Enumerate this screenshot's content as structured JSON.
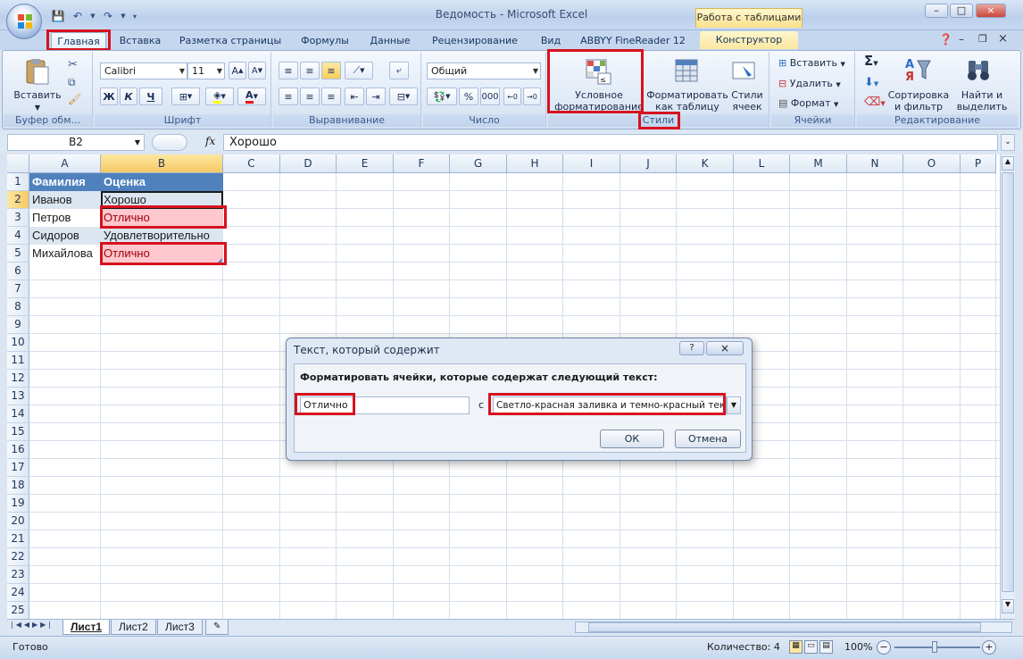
{
  "title_bar": {
    "title": "Ведомость - Microsoft Excel",
    "context_tab_group": "Работа с таблицами",
    "window_buttons": [
      "–",
      "□",
      "×"
    ]
  },
  "ribbon_tabs": [
    "Главная",
    "Вставка",
    "Разметка страницы",
    "Формулы",
    "Данные",
    "Рецензирование",
    "Вид",
    "ABBYY FineReader 12",
    "Конструктор"
  ],
  "ribbon": {
    "clipboard": {
      "label": "Буфер обм...",
      "paste": "Вставить"
    },
    "font": {
      "label": "Шрифт",
      "name": "Calibri",
      "size": "11",
      "bold": "Ж",
      "italic": "К",
      "underline": "Ч"
    },
    "alignment": {
      "label": "Выравнивание"
    },
    "number": {
      "label": "Число",
      "format": "Общий",
      "percent": "%",
      "thousands": "000"
    },
    "styles": {
      "label": "Стили",
      "conditional": "Условное форматирование",
      "as_table": "Форматировать как таблицу",
      "cell_styles": "Стили ячеек"
    },
    "cells": {
      "label": "Ячейки",
      "insert": "Вставить",
      "delete": "Удалить",
      "format": "Формат"
    },
    "editing": {
      "label": "Редактирование",
      "sum": "Σ",
      "sort": "Сортировка и фильтр",
      "find": "Найти и выделить"
    }
  },
  "formula_bar": {
    "name_box": "B2",
    "fx": "fx",
    "value": "Хорошо"
  },
  "columns": [
    "A",
    "B",
    "C",
    "D",
    "E",
    "F",
    "G",
    "H",
    "I",
    "J",
    "K",
    "L",
    "M",
    "N",
    "O",
    "P"
  ],
  "rows": [
    "1",
    "2",
    "3",
    "4",
    "5",
    "6",
    "7",
    "8",
    "9",
    "10",
    "11",
    "12",
    "13",
    "14",
    "15",
    "16",
    "17",
    "18",
    "19",
    "20",
    "21",
    "22",
    "23",
    "24",
    "25"
  ],
  "table": {
    "headers": [
      "Фамилия",
      "Оценка"
    ],
    "rows": [
      [
        "Иванов",
        "Хорошо"
      ],
      [
        "Петров",
        "Отлично"
      ],
      [
        "Сидоров",
        "Удовлетворительно"
      ],
      [
        "Михайлова",
        "Отлично"
      ]
    ]
  },
  "colors": {
    "header_fill": "#4f81bd",
    "band_fill": "#dce6f1",
    "highlight_fill": "#ffc7ce",
    "highlight_text": "#9c0006",
    "annotation": "#d6121e"
  },
  "dialog": {
    "title": "Текст, который содержит",
    "help": "?",
    "close": "×",
    "prompt": "Форматировать ячейки, которые содержат следующий текст:",
    "text_value": "Отлично",
    "with_label": "с",
    "format_value": "Светло-красная заливка и темно-красный текст",
    "ok": "ОК",
    "cancel": "Отмена"
  },
  "sheets": [
    "Лист1",
    "Лист2",
    "Лист3"
  ],
  "status_bar": {
    "ready": "Готово",
    "count": "Количество: 4",
    "zoom": "100%"
  }
}
